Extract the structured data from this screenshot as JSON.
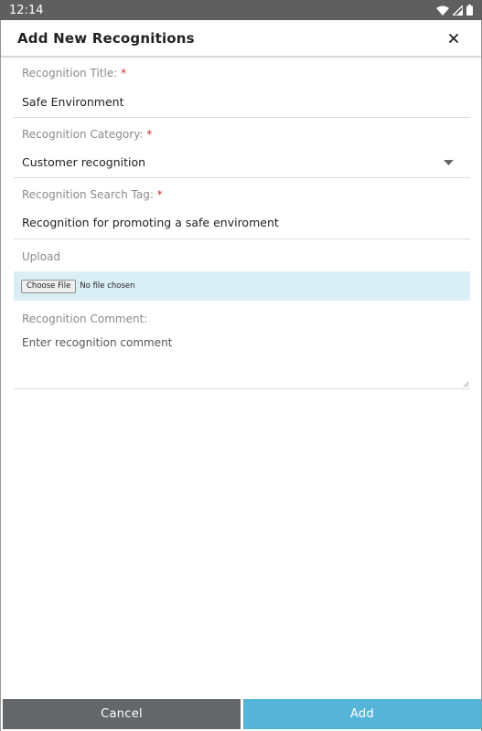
{
  "status_bar": {
    "time": "12:14",
    "icons": [
      "wifi-icon",
      "cell-signal-icon",
      "battery-icon"
    ]
  },
  "dialog": {
    "title": "Add New Recognitions",
    "close_icon": "close-icon"
  },
  "form": {
    "title_field": {
      "label": "Recognition Title:",
      "required_mark": "*",
      "value": "Safe Environment"
    },
    "category_field": {
      "label": "Recognition Category:",
      "required_mark": "*",
      "value": "Customer recognition",
      "icon": "dropdown-caret-icon"
    },
    "tag_field": {
      "label": "Recognition Search Tag:",
      "required_mark": "*",
      "value": "Recognition for promoting a safe enviroment"
    },
    "upload_field": {
      "label": "Upload",
      "button_label": "Choose File",
      "status": "No file chosen"
    },
    "comment_field": {
      "label": "Recognition Comment:",
      "placeholder": "Enter recognition comment",
      "value": ""
    }
  },
  "footer": {
    "cancel_label": "Cancel",
    "add_label": "Add"
  },
  "colors": {
    "status_bar": "#5f5f5f",
    "upload_bg": "#d9eef5",
    "cancel_bg": "#636769",
    "add_bg": "#56b4d9",
    "required": "#d0312d"
  }
}
